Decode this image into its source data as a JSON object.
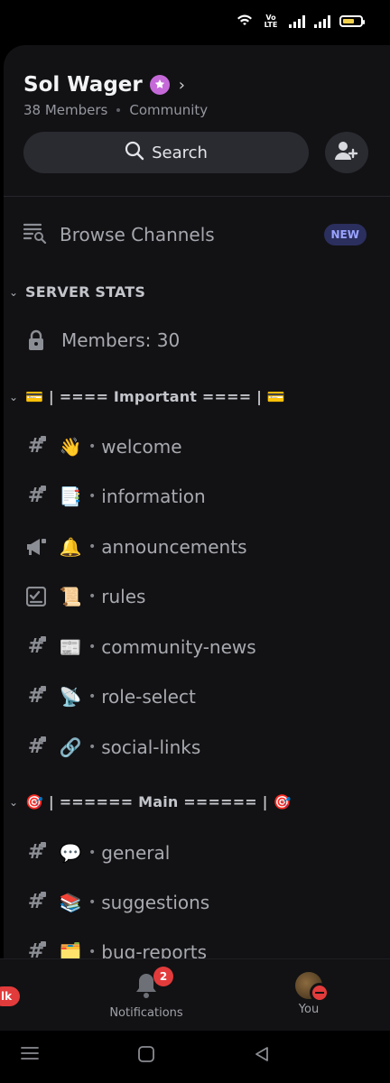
{
  "status_bar": {
    "volte": "VoLTE",
    "battery_level_fraction": 0.55
  },
  "server": {
    "name": "Sol Wager",
    "members_text": "38 Members",
    "type_text": "Community",
    "boost_color": "#c569d9"
  },
  "search": {
    "label": "Search"
  },
  "browse": {
    "label": "Browse Channels",
    "badge": "NEW"
  },
  "categories": [
    {
      "label": "SERVER STATS"
    },
    {
      "label": "💳 | ==== Important ==== | 💳"
    },
    {
      "label": "🎯 | ====== Main ====== | 🎯"
    }
  ],
  "stats_channel": {
    "label": "Members: 30"
  },
  "channels": [
    {
      "emoji": "👋",
      "name": "welcome",
      "icon": "hash-lock-icon"
    },
    {
      "emoji": "📑",
      "name": "information",
      "icon": "hash-lock-icon"
    },
    {
      "emoji": "🔔",
      "name": "announcements",
      "icon": "megaphone-lock-icon"
    },
    {
      "emoji": "📜",
      "name": "rules",
      "icon": "rules-check-icon"
    },
    {
      "emoji": "📰",
      "name": "community-news",
      "icon": "hash-lock-icon"
    },
    {
      "emoji": "📡",
      "name": "role-select",
      "icon": "hash-lock-icon"
    },
    {
      "emoji": "🔗",
      "name": "social-links",
      "icon": "hash-lock-icon"
    },
    {
      "emoji": "💬",
      "name": "general",
      "icon": "hash-lock-icon"
    },
    {
      "emoji": "📚",
      "name": "suggestions",
      "icon": "hash-lock-icon"
    },
    {
      "emoji": "🗂️",
      "name": "bug-reports",
      "icon": "hash-lock-icon"
    }
  ],
  "bottom_nav": {
    "left_badge": "lk",
    "notifications_label": "Notifications",
    "notifications_count": "2",
    "you_label": "You"
  },
  "colors": {
    "accent_red": "#e23b3b",
    "new_badge": "#9aa3ff",
    "panel_bg": "#121214"
  }
}
